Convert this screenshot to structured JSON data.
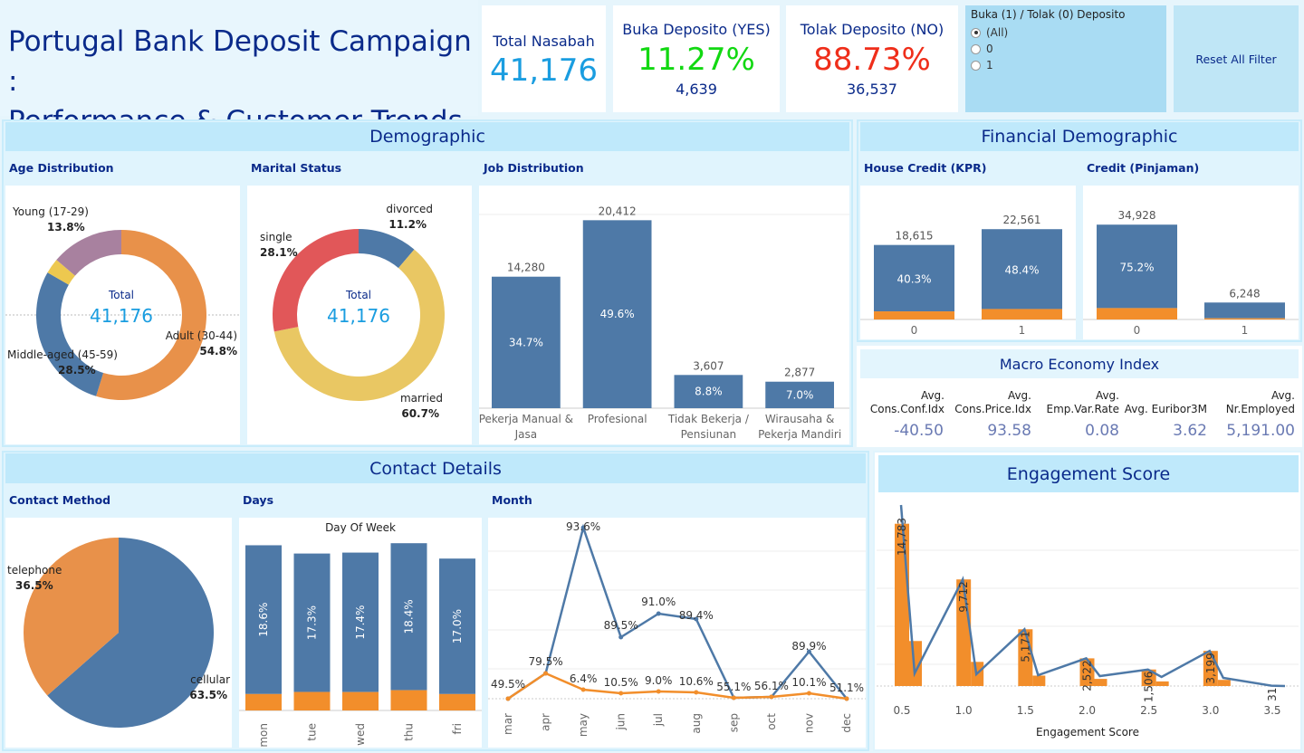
{
  "header": {
    "title_line1": "Portugal Bank Deposit Campaign :",
    "title_line2": "Performance & Customer Trends"
  },
  "kpis": {
    "total_label": "Total Nasabah",
    "total_value": "41,176",
    "yes_label": "Buka Deposito (YES)",
    "yes_pct": "11.27%",
    "yes_count": "4,639",
    "no_label": "Tolak Deposito (NO)",
    "no_pct": "88.73%",
    "no_count": "36,537"
  },
  "filter": {
    "title": "Buka (1) / Tolak (0) Deposito",
    "options": [
      "(All)",
      "0",
      "1"
    ],
    "selected": "(All)",
    "reset_label": "Reset All Filter"
  },
  "demographic": {
    "title": "Demographic",
    "age_title": "Age Distribution",
    "marital_title": "Marital Status",
    "job_title": "Job Distribution"
  },
  "financial": {
    "title": "Financial Demographic",
    "house_title": "House Credit (KPR)",
    "credit_title": "Credit (Pinjaman)"
  },
  "macro": {
    "title": "Macro Economy Index",
    "headers": [
      [
        "Avg.",
        "Cons.Conf.Idx"
      ],
      [
        "Avg.",
        "Cons.Price.Idx"
      ],
      [
        "Avg.",
        "Emp.Var.Rate"
      ],
      [
        "",
        "Avg. Euribor3M"
      ],
      [
        "Avg.",
        "Nr.Employed"
      ]
    ],
    "values": [
      "-40.50",
      "93.58",
      "0.08",
      "3.62",
      "5,191.00"
    ]
  },
  "contact": {
    "title": "Contact Details",
    "method_title": "Contact Method",
    "days_title": "Days",
    "month_title": "Month"
  },
  "engagement": {
    "title": "Engagement Score"
  },
  "chart_data": [
    {
      "id": "age",
      "type": "pie",
      "donut": true,
      "center_label": "Total",
      "center_value": "41,176",
      "slices": [
        {
          "name": "Adult (30-44)",
          "pct": "54.8%",
          "value": 54.8,
          "color": "#e8914a"
        },
        {
          "name": "Middle-aged (45-59)",
          "pct": "28.5%",
          "value": 28.5,
          "color": "#4e79a7"
        },
        {
          "name": "",
          "pct": "",
          "value": 2.9,
          "color": "#edc84f"
        },
        {
          "name": "Young (17-29)",
          "pct": "13.8%",
          "value": 13.8,
          "color": "#a8819f"
        }
      ]
    },
    {
      "id": "marital",
      "type": "pie",
      "donut": true,
      "center_label": "Total",
      "center_value": "41,176",
      "slices": [
        {
          "name": "divorced",
          "pct": "11.2%",
          "value": 11.2,
          "color": "#4e79a7"
        },
        {
          "name": "married",
          "pct": "60.7%",
          "value": 60.7,
          "color": "#e9c763"
        },
        {
          "name": "single",
          "pct": "28.1%",
          "value": 28.1,
          "color": "#e15759"
        }
      ]
    },
    {
      "id": "job",
      "type": "bar",
      "categories": [
        [
          "Pekerja Manual &",
          "Jasa"
        ],
        [
          "Profesional"
        ],
        [
          "Tidak Bekerja /",
          "Pensiunan"
        ],
        [
          "Wirausaha &",
          "Pekerja Mandiri"
        ]
      ],
      "values": [
        14280,
        20412,
        3607,
        2877
      ],
      "value_labels": [
        "14,280",
        "20,412",
        "3,607",
        "2,877"
      ],
      "pct_labels": [
        "34.7%",
        "49.6%",
        "8.8%",
        "7.0%"
      ],
      "ylim": [
        0,
        23000
      ],
      "color": "#4e79a7"
    },
    {
      "id": "house",
      "type": "bar",
      "stacked": true,
      "categories": [
        "0",
        "1"
      ],
      "totals": [
        18615,
        22561
      ],
      "total_labels": [
        "18,615",
        "22,561"
      ],
      "yes_values": [
        2026,
        2613
      ],
      "pct_labels": [
        "40.3%",
        "48.4%"
      ],
      "ylim": [
        0,
        26000
      ],
      "colors": {
        "no": "#4e79a7",
        "yes": "#f28e2b"
      }
    },
    {
      "id": "credit",
      "type": "bar",
      "stacked": true,
      "categories": [
        "0",
        "1"
      ],
      "totals": [
        34928,
        6248
      ],
      "total_labels": [
        "34,928",
        "6,248"
      ],
      "yes_values": [
        4197,
        442
      ],
      "pct_labels": [
        "75.2%",
        ""
      ],
      "ylim": [
        0,
        39000
      ],
      "colors": {
        "no": "#4e79a7",
        "yes": "#f28e2b"
      }
    },
    {
      "id": "contact",
      "type": "pie",
      "slices": [
        {
          "name": "cellular",
          "pct": "63.5%",
          "value": 63.5,
          "color": "#4e79a7"
        },
        {
          "name": "telephone",
          "pct": "36.5%",
          "value": 36.5,
          "color": "#e8914a"
        }
      ]
    },
    {
      "id": "days",
      "type": "bar",
      "stacked": true,
      "title": "Day Of Week",
      "categories": [
        "mon",
        "tue",
        "wed",
        "thu",
        "fri"
      ],
      "totals": [
        8512,
        8086,
        8134,
        8618,
        7826
      ],
      "yes_values": [
        847,
        953,
        949,
        1045,
        846
      ],
      "pct_labels": [
        "18.6%",
        "17.3%",
        "17.4%",
        "18.4%",
        "17.0%"
      ],
      "ylim": [
        0,
        9000
      ],
      "colors": {
        "no": "#4e79a7",
        "yes": "#f28e2b"
      }
    },
    {
      "id": "month",
      "type": "line",
      "categories": [
        "mar",
        "apr",
        "may",
        "jun",
        "jul",
        "aug",
        "sep",
        "oct",
        "nov",
        "dec"
      ],
      "series": [
        {
          "color": "#4e79a7",
          "values": [
            49.5,
            79.5,
            93.6,
            89.5,
            91.0,
            89.4,
            55.1,
            56.1,
            89.9,
            51.1
          ]
        },
        {
          "color": "#f28e2b",
          "values": [
            49.5,
            79.5,
            6.4,
            10.5,
            9.0,
            10.6,
            55.1,
            56.1,
            10.1,
            51.1
          ]
        }
      ],
      "labels": [
        "49.5%",
        "79.5%",
        "93.6%",
        "89.5%",
        "91.0%",
        "89.4%",
        "55.1%",
        "56.1%",
        "89.9%",
        "51.1%"
      ],
      "low_labels": [
        "",
        "",
        "6.4%",
        "10.5%",
        "9.0%",
        "10.6%",
        "",
        "",
        "10.1%",
        ""
      ]
    },
    {
      "id": "engagement",
      "type": "bar",
      "xlabel": "Engagement Score",
      "x_ticks": [
        "0.5",
        "1.0",
        "1.5",
        "2.0",
        "2.5",
        "3.0",
        "3.5"
      ],
      "x": [
        0.5,
        1.0,
        1.5,
        2.0,
        2.5,
        3.0,
        3.5
      ],
      "values": [
        14783,
        9712,
        5171,
        2522,
        1506,
        3199,
        31
      ],
      "value_labels": [
        "14,783",
        "9,712",
        "5,171",
        "2,522",
        "1,506",
        "3,199",
        "31"
      ],
      "minor_values": [
        4100,
        2200,
        950,
        650,
        420,
        560,
        0
      ],
      "ylim": [
        0,
        15500
      ],
      "colors": {
        "bar": "#f28e2b",
        "line": "#4e79a7"
      }
    }
  ]
}
